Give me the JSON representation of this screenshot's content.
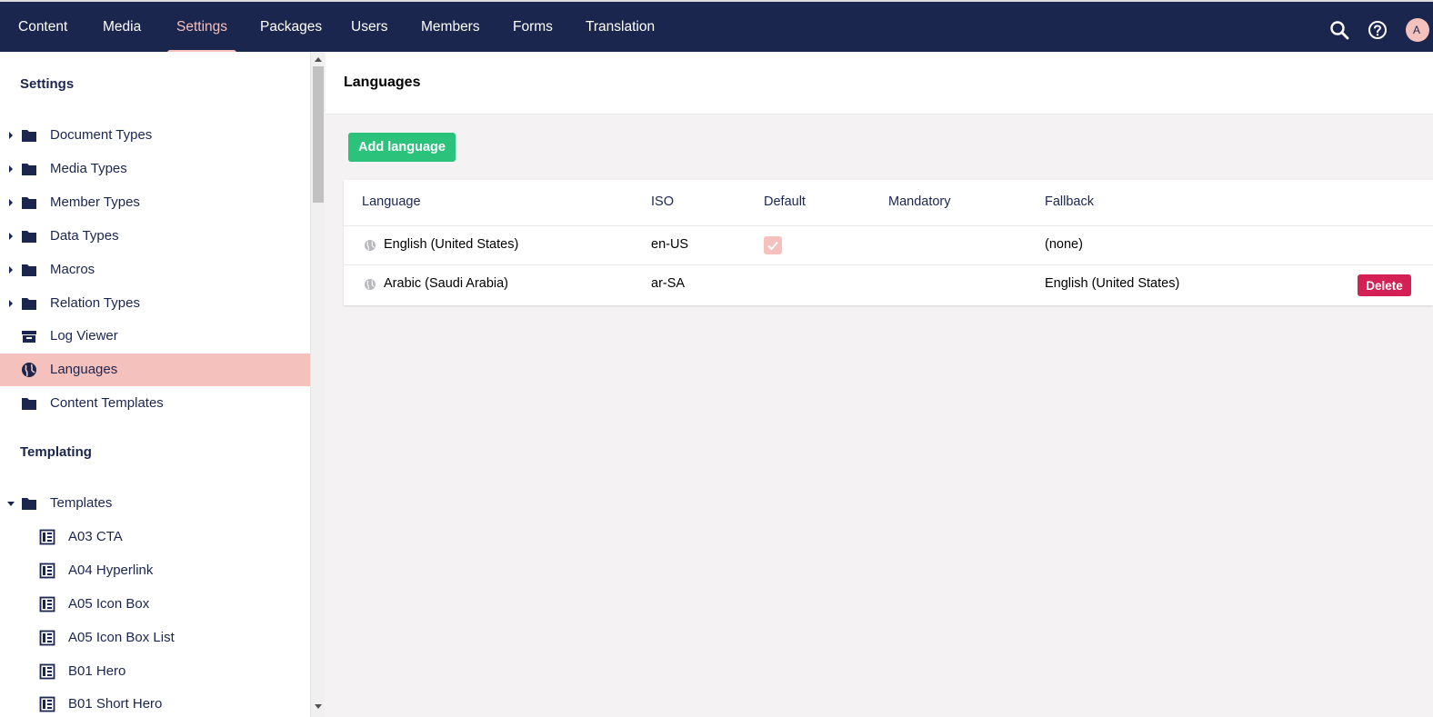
{
  "topnav": {
    "items": [
      {
        "label": "Content"
      },
      {
        "label": "Media"
      },
      {
        "label": "Settings"
      },
      {
        "label": "Packages"
      },
      {
        "label": "Users"
      },
      {
        "label": "Members"
      },
      {
        "label": "Forms"
      },
      {
        "label": "Translation"
      }
    ],
    "active": "Settings",
    "avatar_initial": "A",
    "icons": [
      "search-icon",
      "help-icon"
    ]
  },
  "sidebar": {
    "settings_heading": "Settings",
    "settings_items": [
      {
        "label": "Document Types",
        "icon": "folder-icon",
        "expandable": true
      },
      {
        "label": "Media Types",
        "icon": "folder-icon",
        "expandable": true
      },
      {
        "label": "Member Types",
        "icon": "folder-icon",
        "expandable": true
      },
      {
        "label": "Data Types",
        "icon": "folder-icon",
        "expandable": true
      },
      {
        "label": "Macros",
        "icon": "folder-icon",
        "expandable": true
      },
      {
        "label": "Relation Types",
        "icon": "folder-icon",
        "expandable": true
      },
      {
        "label": "Log Viewer",
        "icon": "archive-icon",
        "expandable": false
      },
      {
        "label": "Languages",
        "icon": "globe-icon",
        "expandable": false,
        "active": true
      },
      {
        "label": "Content Templates",
        "icon": "folder-icon",
        "expandable": false
      }
    ],
    "templating_heading": "Templating",
    "templates_folder": {
      "label": "Templates",
      "expanded": true
    },
    "templates": [
      {
        "label": "A03 CTA"
      },
      {
        "label": "A04 Hyperlink"
      },
      {
        "label": "A05 Icon Box"
      },
      {
        "label": "A05 Icon Box List"
      },
      {
        "label": "B01 Hero"
      },
      {
        "label": "B01 Short Hero"
      }
    ]
  },
  "main": {
    "title": "Languages",
    "add_button": "Add language",
    "table": {
      "headers": [
        "Language",
        "ISO",
        "Default",
        "Mandatory",
        "Fallback"
      ],
      "rows": [
        {
          "language": "English (United States)",
          "iso": "en-US",
          "default": true,
          "mandatory": false,
          "fallback": "(none)",
          "deletable": false
        },
        {
          "language": "Arabic (Saudi Arabia)",
          "iso": "ar-SA",
          "default": false,
          "mandatory": false,
          "fallback": "English (United States)",
          "deletable": true,
          "delete_label": "Delete"
        }
      ]
    }
  },
  "colors": {
    "topbar": "#1b264f",
    "accent": "#f5c1bc",
    "add_button": "#2bc37c",
    "delete_button": "#d42054"
  }
}
